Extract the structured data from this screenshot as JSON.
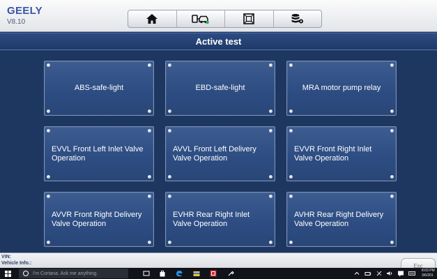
{
  "header": {
    "brand": "GEELY",
    "version": "V8.10",
    "toolbar": [
      "home-icon",
      "vehicle-diagnosis-icon",
      "fullscreen-icon",
      "database-settings-icon"
    ]
  },
  "title": "Active test",
  "tiles": [
    {
      "label": "ABS-safe-light"
    },
    {
      "label": "EBD-safe-light"
    },
    {
      "label": "MRA motor pump relay"
    },
    {
      "label": "EVVL Front Left Inlet Valve Operation"
    },
    {
      "label": "AVVL Front Left Delivery Valve Operation"
    },
    {
      "label": "EVVR Front Right Inlet Valve Operation"
    },
    {
      "label": "AVVR Front Right Delivery Valve Operation"
    },
    {
      "label": "EVHR Rear Right Inlet Valve Operation"
    },
    {
      "label": "AVHR Rear Right Delivery Valve Operation"
    }
  ],
  "footer": {
    "vin_label": "VIN:",
    "vehicle_info_label": "Vehicle Info.:",
    "esc_label": "Esc"
  },
  "taskbar": {
    "search_placeholder": "I'm Cortana. Ask me anything.",
    "time": "8:03 PM",
    "date": "3/6/201"
  }
}
